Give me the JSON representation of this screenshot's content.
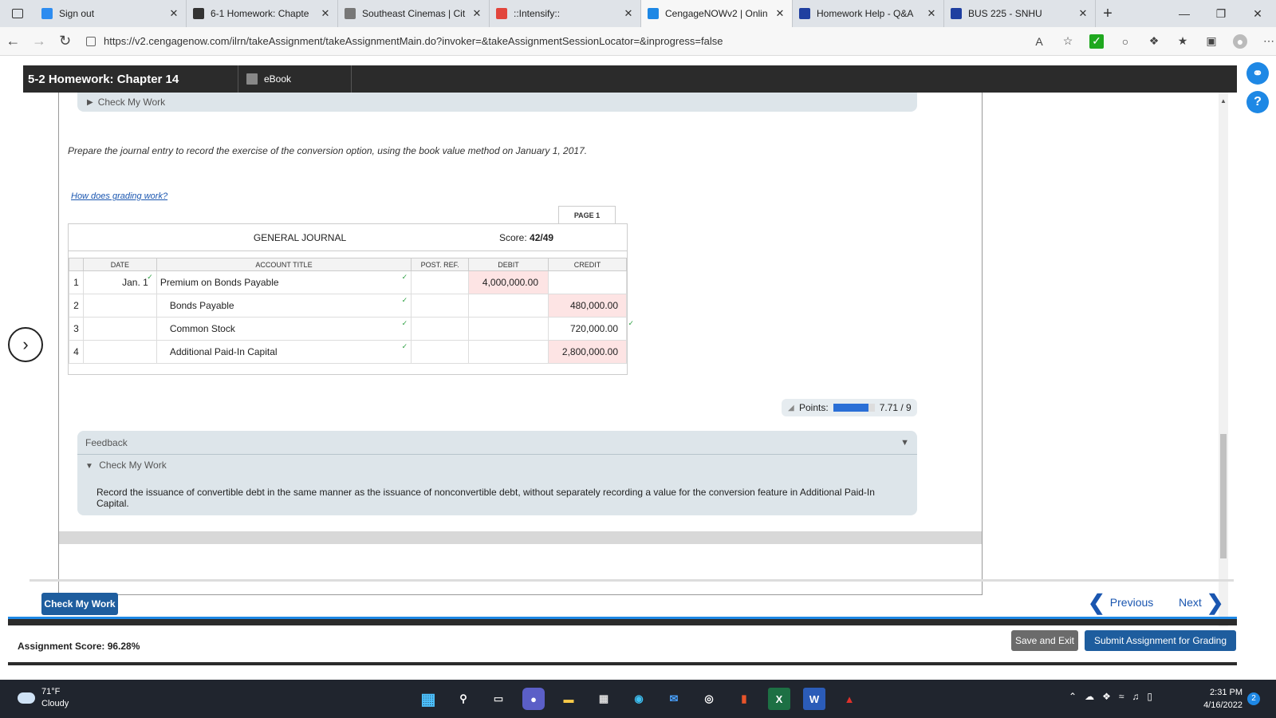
{
  "browser": {
    "tabs": [
      {
        "title": "Sign out",
        "icon": "windows-icon",
        "color": "#2d8cf0"
      },
      {
        "title": "6-1 Homework: Chapte",
        "icon": "d2l-icon",
        "color": "#333333"
      },
      {
        "title": "Southeast Cinemas | Cit",
        "icon": "page-icon",
        "color": "#777777"
      },
      {
        "title": "::Intensify::",
        "icon": "intensify-icon",
        "color": "#e2453c"
      },
      {
        "title": "CengageNOWv2 | Onlin",
        "icon": "cengage-icon",
        "color": "#1e88e5"
      },
      {
        "title": "Homework Help - Q&A",
        "icon": "star-icon",
        "color": "#1f3fa0"
      },
      {
        "title": "BUS 225 - SNHU",
        "icon": "star-icon",
        "color": "#1f3fa0"
      }
    ],
    "active_tab_index": 4,
    "url": "https://v2.cengagenow.com/ilrn/takeAssignment/takeAssignmentMain.do?invoker=&takeAssignmentSessionLocator=&inprogress=false"
  },
  "assignment": {
    "title": "5-2 Homework: Chapter 14",
    "ebook_label": "eBook",
    "check_my_work_label": "Check My Work",
    "instruction": "Prepare the journal entry to record the exercise of the conversion option, using the book value method on January 1, 2017.",
    "how_grading_link": "How does grading work?"
  },
  "journal": {
    "page_label": "PAGE 1",
    "title": "GENERAL JOURNAL",
    "score_label": "Score:",
    "score_value": "42/49",
    "columns": [
      "DATE",
      "ACCOUNT TITLE",
      "POST. REF.",
      "DEBIT",
      "CREDIT"
    ],
    "rows": [
      {
        "num": "1",
        "date": "Jan. 1",
        "account": "Premium on Bonds Payable",
        "debit": "4,000,000.00",
        "credit": "",
        "debit_wrong": true,
        "credit_wrong": false
      },
      {
        "num": "2",
        "date": "",
        "account": "Bonds Payable",
        "debit": "",
        "credit": "480,000.00",
        "debit_wrong": false,
        "credit_wrong": true
      },
      {
        "num": "3",
        "date": "",
        "account": "Common Stock",
        "debit": "",
        "credit": "720,000.00",
        "debit_wrong": false,
        "credit_wrong": false
      },
      {
        "num": "4",
        "date": "",
        "account": "Additional Paid-In Capital",
        "debit": "",
        "credit": "2,800,000.00",
        "debit_wrong": false,
        "credit_wrong": true
      }
    ]
  },
  "points": {
    "label": "Points:",
    "value": "7.71 / 9",
    "fraction": 0.857
  },
  "feedback": {
    "heading": "Feedback",
    "check_my_work_label": "Check My Work",
    "text": "Record the issuance of convertible debt in the same manner as the issuance of nonconvertible debt, without separately recording a value for the conversion feature in Additional Paid-In Capital."
  },
  "footer": {
    "check_my_work_button": "Check My Work",
    "previous": "Previous",
    "next": "Next",
    "assignment_score": "Assignment Score: 96.28%",
    "save_exit": "Save and Exit",
    "submit": "Submit Assignment for Grading"
  },
  "taskbar": {
    "temperature": "71°F",
    "condition": "Cloudy",
    "time": "2:31 PM",
    "date": "4/16/2022",
    "notification_count": "2"
  },
  "colors": {
    "accent": "#1e5d9e",
    "error_cell": "#fde4e4",
    "correct_check": "#2ea043"
  }
}
